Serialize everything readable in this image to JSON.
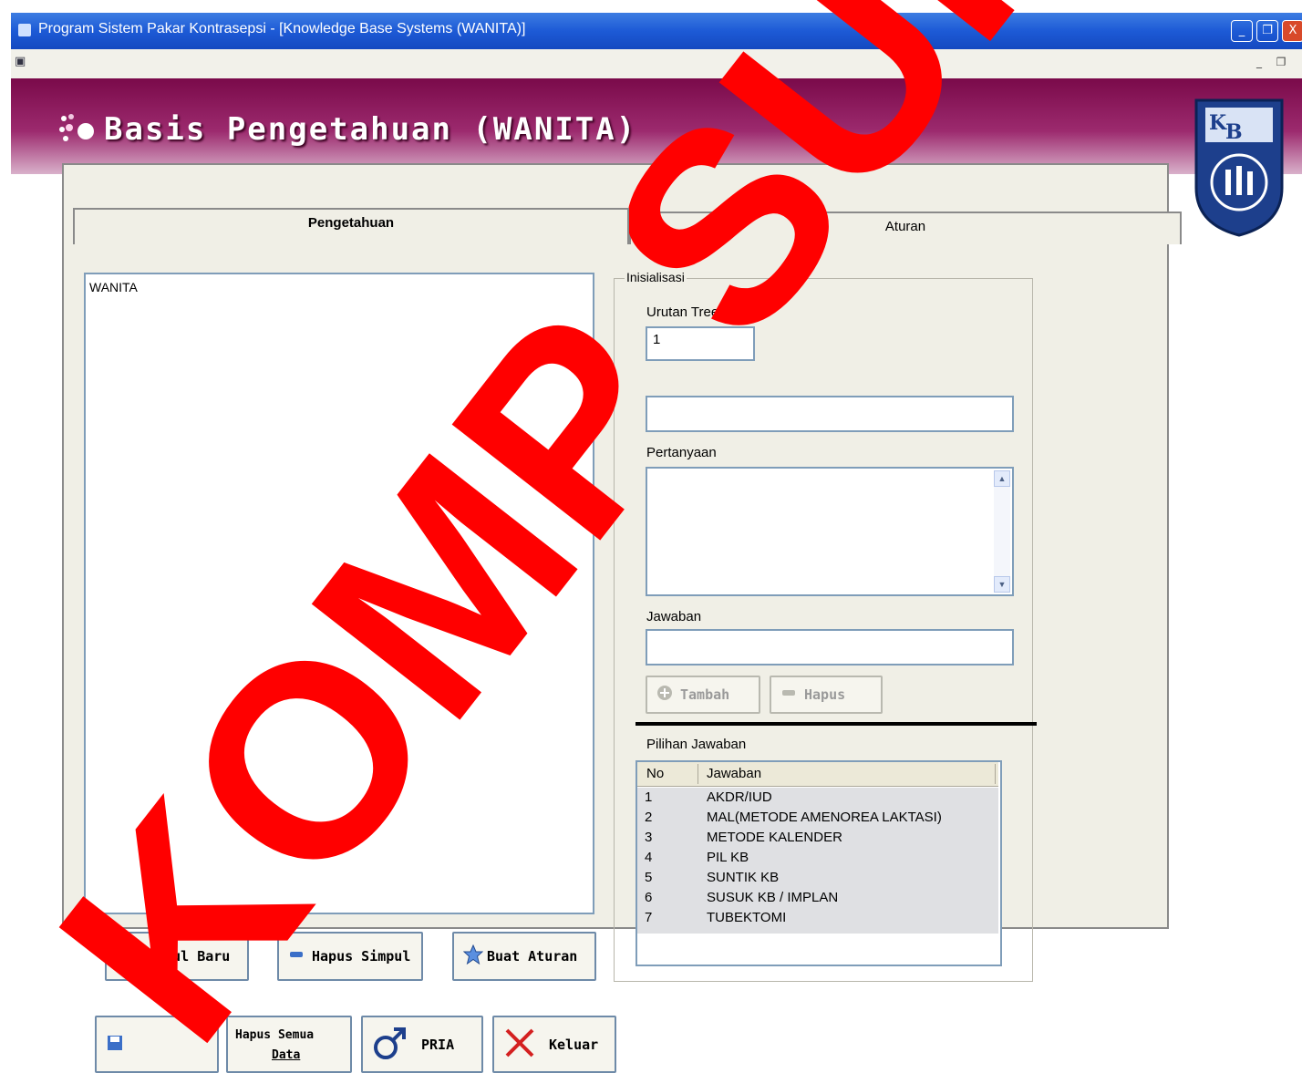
{
  "window": {
    "title": "Program Sistem Pakar Kontrasepsi - [Knowledge Base Systems (WANITA)]",
    "minimize_glyph": "_",
    "restore_glyph": "❐",
    "close_glyph": "X"
  },
  "menubar": {
    "sys_icon": "form-icon",
    "mdi_min": "_",
    "mdi_restore": "❐"
  },
  "header": {
    "title": "Basis Pengetahuan (WANITA)"
  },
  "tabs": [
    {
      "label": "Pengetahuan",
      "active": true
    },
    {
      "label": "Aturan",
      "active": false
    }
  ],
  "tree": {
    "root": "WANITA"
  },
  "inisialisasi": {
    "title": "Inisialisasi",
    "urutan_label": "Urutan Tree",
    "urutan_value": "1",
    "field2_value": "",
    "pertanyaan_label": "Pertanyaan",
    "pertanyaan_value": "",
    "jawaban_label": "Jawaban",
    "jawaban_value": ""
  },
  "buttons": {
    "tambah": "Tambah",
    "hapus": "Hapus",
    "simpul_baru": "Simpul Baru",
    "hapus_simpul": "Hapus Simpul",
    "buat_aturan": "Buat Aturan",
    "hapus_semua_line1": "Hapus Semua",
    "hapus_semua_line2": "Data",
    "pria": "PRIA",
    "keluar": "Keluar"
  },
  "pilihan": {
    "label": "Pilihan Jawaban",
    "headers": [
      "No",
      "Jawaban"
    ],
    "rows": [
      {
        "no": "1",
        "jawaban": "AKDR/IUD"
      },
      {
        "no": "2",
        "jawaban": "MAL(METODE AMENOREA LAKTASI)"
      },
      {
        "no": "3",
        "jawaban": "METODE KALENDER"
      },
      {
        "no": "4",
        "jawaban": "PIL KB"
      },
      {
        "no": "5",
        "jawaban": "SUNTIK KB"
      },
      {
        "no": "6",
        "jawaban": "SUSUK KB / IMPLAN"
      },
      {
        "no": "7",
        "jawaban": "TUBEKTOMI"
      }
    ]
  },
  "watermark": {
    "text": "KOMP SURAL",
    "color": "#ff0000"
  },
  "colors": {
    "titlebar": "#1d5ad6",
    "header": "#7a0a4a",
    "panel": "#f0efe6",
    "accent": "#ff0000"
  }
}
